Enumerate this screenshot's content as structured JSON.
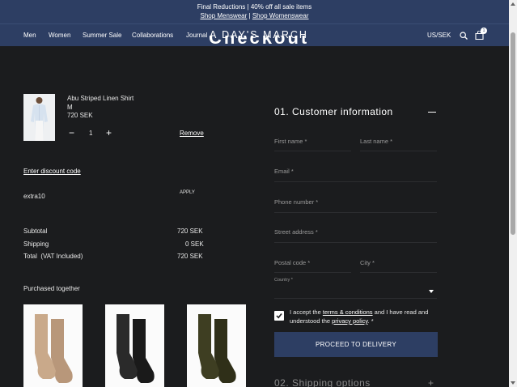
{
  "announcement": {
    "line1": "Final Reductions | 40% off all sale items",
    "link_menswear": "Shop Menswear",
    "separator": " | ",
    "link_womenswear": "Shop Womenswear"
  },
  "nav": {
    "items": [
      "Men",
      "Women",
      "Summer Sale",
      "Collaborations",
      "Journal"
    ],
    "logo": "A DAY'S MARCH",
    "currency": "US/SEK",
    "cart_count": "1"
  },
  "page": {
    "heading": "Checkout"
  },
  "cart": {
    "item": {
      "name": "Abu Striped Linen Shirt",
      "size": "M",
      "price": "720 SEK",
      "quantity": "1",
      "remove_label": "Remove"
    },
    "discount_link": "Enter discount code",
    "discount_code": "extra10",
    "apply_label": "APPLY",
    "subtotal_label": "Subtotal",
    "subtotal_value": "720 SEK",
    "shipping_label": "Shipping",
    "shipping_value": "0 SEK",
    "total_label": "Total",
    "total_suffix": "(VAT Included)",
    "total_value": "720 SEK",
    "purchased_together_title": "Purchased together",
    "colors": {
      "sock_beige": "#c9a98a",
      "sock_black": "#222222",
      "sock_olive": "#3a3a1f"
    }
  },
  "customer_info": {
    "title": "01. Customer information",
    "first_name": "First name *",
    "last_name": "Last name *",
    "email": "Email *",
    "phone": "Phone number *",
    "street": "Street address *",
    "postal": "Postal code *",
    "city": "City *",
    "country": "Country *",
    "terms_pre": "I accept the ",
    "terms_link": "terms & conditions",
    "terms_mid": " and I have read and understood the ",
    "privacy_link": "privacy policy",
    "terms_post": ". *",
    "proceed_label": "PROCEED TO DELIVERY"
  },
  "shipping_options": {
    "title": "02. Shipping options"
  },
  "colors": {
    "accent": "#2d3e63",
    "background": "#1b1c1e"
  }
}
